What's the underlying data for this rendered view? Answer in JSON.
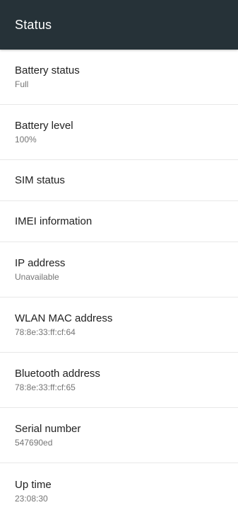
{
  "toolbar": {
    "title": "Status"
  },
  "items": [
    {
      "title": "Battery status",
      "summary": "Full"
    },
    {
      "title": "Battery level",
      "summary": "100%"
    },
    {
      "title": "SIM status"
    },
    {
      "title": "IMEI information"
    },
    {
      "title": "IP address",
      "summary": "Unavailable"
    },
    {
      "title": "WLAN MAC address",
      "summary": "78:8e:33:ff:cf:64"
    },
    {
      "title": "Bluetooth address",
      "summary": "78:8e:33:ff:cf:65"
    },
    {
      "title": "Serial number",
      "summary": "547690ed"
    },
    {
      "title": "Up time",
      "summary": "23:08:30"
    }
  ]
}
